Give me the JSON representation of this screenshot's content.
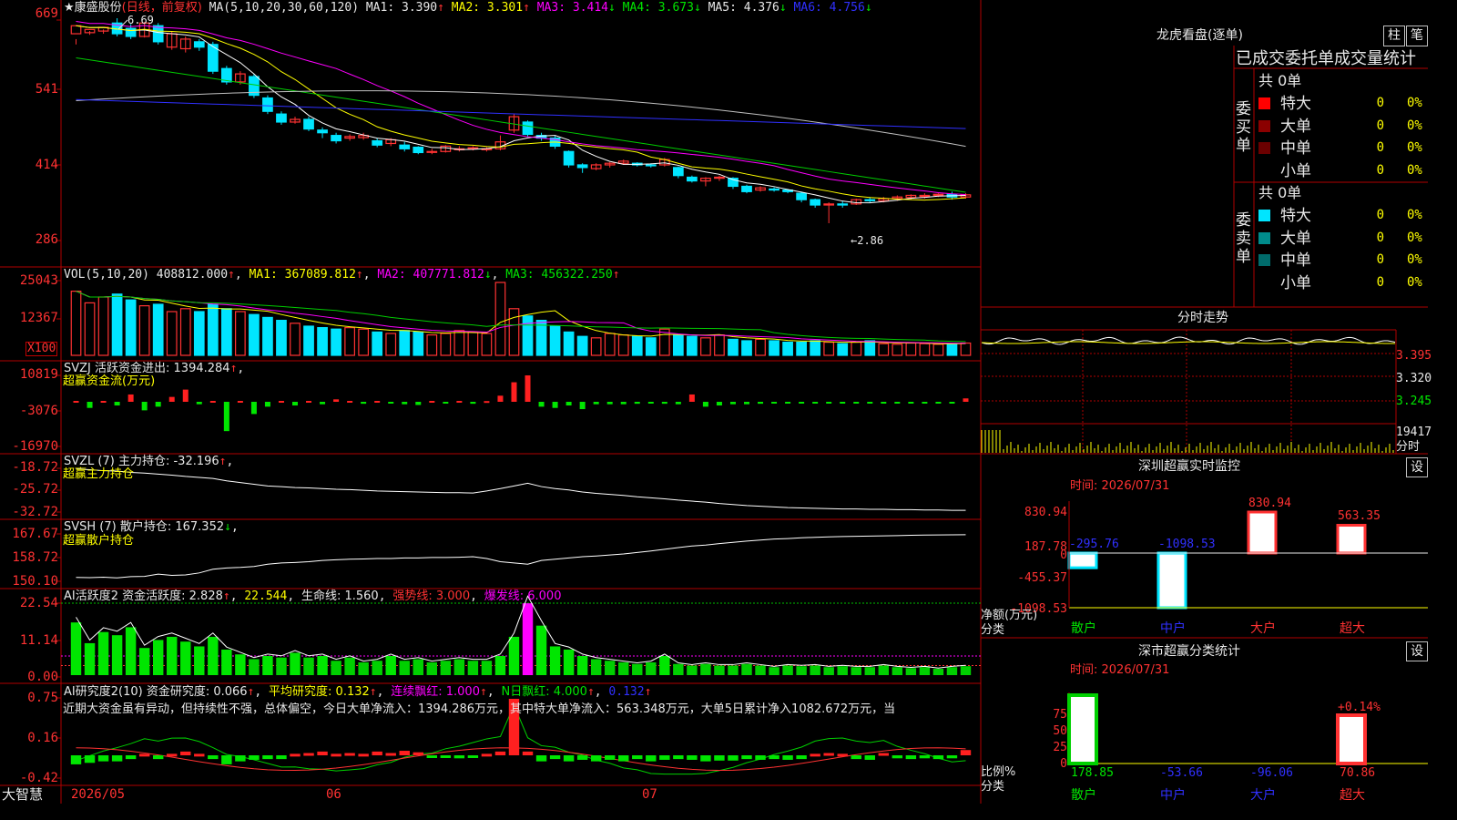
{
  "colors": {
    "up": "#ff3232",
    "down": "#00e5ff",
    "ma1": "#ffffff",
    "ma2": "#ffff00",
    "ma3": "#ff00ff",
    "ma4": "#00cc00",
    "ma5": "#c0c0c0",
    "ma6": "#3030ff",
    "pos": "#ff2020",
    "neg": "#00e600",
    "grid": "#c00000",
    "bg": "#000000"
  },
  "header": {
    "star": "★",
    "stock_name": "康盛股份",
    "period": "(日线，前复权)",
    "ma_params": "MA(5,10,20,30,60,120)",
    "ma1": "MA1: 3.390",
    "ma2": "MA2: 3.301",
    "ma3": "MA3: 3.414",
    "ma4": "MA4: 3.673",
    "ma5": "MA5: 4.376",
    "ma6": "MA6: 4.756",
    "up_arrow": "↑",
    "down_arrow": "↓",
    "peak_label": "6.69",
    "trough_label": "←2.86"
  },
  "price_axis": {
    "ticks": [
      "669",
      "541",
      "414",
      "286"
    ]
  },
  "vol": {
    "title": "VOL(5,10,20)",
    "val": "408812.000",
    "ma1": "MA1: 367089.812",
    "ma2": "MA2: 407771.812",
    "ma3": "MA3: 456322.250",
    "ticks": [
      "25043",
      "12367"
    ],
    "unit": "X100"
  },
  "svzj": {
    "title": "SVZJ  活跃资金进出: 1394.284",
    "sub": "超赢资金流(万元)",
    "ticks": [
      "10819",
      "-3076",
      "-16970"
    ]
  },
  "svzl": {
    "title": "SVZL (7) 主力持仓: -32.196",
    "sub": "超赢主力持仓",
    "ticks": [
      "-18.72",
      "-25.72",
      "-32.72"
    ]
  },
  "svsh": {
    "title": "SVSH (7) 散户持仓: 167.352",
    "sub": "超赢散户持仓",
    "ticks": [
      "167.67",
      "158.72",
      "150.10"
    ]
  },
  "ai2": {
    "title": "AI活跃度2 资金活跃度: 2.828",
    "v2": "22.544",
    "life": "生命线: 1.560",
    "strong": "强势线: 3.000",
    "burst": "爆发线: 6.000",
    "ticks": [
      "22.54",
      "11.14",
      "0.00"
    ]
  },
  "ai_res": {
    "title": "AI研究度2(10) 资金研究度: 0.066",
    "avg": "平均研究度: 0.132",
    "cont": "连续飘红: 1.000",
    "nred": "N日飘红: 4.000",
    "last": "0.132",
    "comment": "近期大资金虽有异动，但持续性不强，总体偏空，今日大单净流入：1394.286万元，其中特大单净流入：563.348万元，大单5日累计净入1082.672万元，当",
    "ticks": [
      "0.75",
      "0.16",
      "-0.42"
    ]
  },
  "date_axis": {
    "labels": [
      "2026/05",
      "06",
      "07"
    ]
  },
  "footer": {
    "brand": "大智慧"
  },
  "dragon": {
    "title": "龙虎看盘(逐单)",
    "btn1": "柱",
    "btn2": "笔",
    "header": "已成交委托单成交量统计",
    "buy_label": "委买单",
    "sell_label": "委卖单",
    "buy_total": "共 0单",
    "sell_total": "共 0单",
    "buy_rows": [
      {
        "name": "特大",
        "count": "0",
        "pct": "0%"
      },
      {
        "name": "大单",
        "count": "0",
        "pct": "0%"
      },
      {
        "name": "中单",
        "count": "0",
        "pct": "0%"
      },
      {
        "name": "小单",
        "count": "0",
        "pct": "0%"
      }
    ],
    "sell_rows": [
      {
        "name": "特大",
        "count": "0",
        "pct": "0%"
      },
      {
        "name": "大单",
        "count": "0",
        "pct": "0%"
      },
      {
        "name": "中单",
        "count": "0",
        "pct": "0%"
      },
      {
        "name": "小单",
        "count": "0",
        "pct": "0%"
      }
    ]
  },
  "intraday": {
    "title": "分时走势",
    "ticks": [
      "3.395",
      "3.320",
      "3.245"
    ],
    "vol_tick": "19417",
    "label": "分时"
  },
  "monitor": {
    "title": "深圳超赢实时监控",
    "btn": "设",
    "time": "时间: 2026/07/31",
    "yticks": [
      "830.94",
      "187.78",
      "0",
      "-455.37",
      "-1098.53"
    ],
    "ylabel": "净额(万元)",
    "xlabel": "分类",
    "cats": [
      "散户",
      "中户",
      "大户",
      "超大"
    ],
    "values": [
      -295.76,
      -1098.53,
      830.94,
      563.35
    ],
    "labels": [
      "-295.76",
      "-1098.53",
      "830.94",
      "563.35"
    ]
  },
  "stats": {
    "title": "深市超赢分类统计",
    "btn": "设",
    "time": "时间: 2026/07/31",
    "yticks": [
      "75",
      "50",
      "25",
      "0"
    ],
    "ylabel": "比例%",
    "xlabel": "分类",
    "cats": [
      "散户",
      "中户",
      "大户",
      "超大"
    ],
    "values": [
      "178.85",
      "-53.66",
      "-96.06",
      "70.86"
    ],
    "top_label": "+0.14%"
  },
  "chart_data": {
    "type": "candlestick",
    "dates": [
      "2026/05",
      "06",
      "07"
    ],
    "ohlc": [
      [
        6.4,
        6.55,
        6.3,
        6.2
      ],
      [
        6.42,
        6.48,
        6.45,
        6.38
      ],
      [
        6.45,
        6.52,
        6.48,
        6.4
      ],
      [
        6.6,
        6.4,
        6.69,
        6.35
      ],
      [
        6.5,
        6.35,
        6.58,
        6.3
      ],
      [
        6.35,
        6.6,
        6.62,
        6.33
      ],
      [
        6.55,
        6.25,
        6.6,
        6.2
      ],
      [
        6.15,
        6.4,
        6.45,
        6.1
      ],
      [
        6.12,
        6.3,
        6.35,
        6.05
      ],
      [
        6.25,
        6.15,
        6.3,
        6.08
      ],
      [
        6.2,
        5.7,
        6.25,
        5.65
      ],
      [
        5.75,
        5.5,
        5.8,
        5.45
      ],
      [
        5.5,
        5.65,
        5.7,
        5.45
      ],
      [
        5.6,
        5.25,
        5.65,
        5.2
      ],
      [
        5.2,
        4.95,
        5.25,
        4.9
      ],
      [
        4.9,
        4.75,
        4.95,
        4.7
      ],
      [
        4.75,
        4.8,
        4.85,
        4.72
      ],
      [
        4.8,
        4.62,
        4.85,
        4.58
      ],
      [
        4.6,
        4.55,
        4.65,
        4.45
      ],
      [
        4.5,
        4.4,
        4.55,
        4.35
      ],
      [
        4.45,
        4.48,
        4.52,
        4.4
      ],
      [
        4.46,
        4.5,
        4.55,
        4.42
      ],
      [
        4.4,
        4.32,
        4.45,
        4.28
      ],
      [
        4.35,
        4.42,
        4.45,
        4.3
      ],
      [
        4.32,
        4.25,
        4.38,
        4.2
      ],
      [
        4.28,
        4.18,
        4.3,
        4.15
      ],
      [
        4.2,
        4.2,
        4.25,
        4.15
      ],
      [
        4.2,
        4.3,
        4.32,
        4.18
      ],
      [
        4.25,
        4.25,
        4.3,
        4.2
      ],
      [
        4.25,
        4.27,
        4.3,
        4.22
      ],
      [
        4.25,
        4.25,
        4.28,
        4.2
      ],
      [
        4.25,
        4.38,
        4.5,
        4.22
      ],
      [
        4.6,
        4.85,
        4.9,
        4.55
      ],
      [
        4.75,
        4.52,
        4.78,
        4.48
      ],
      [
        4.5,
        4.45,
        4.55,
        4.4
      ],
      [
        4.45,
        4.3,
        4.5,
        4.25
      ],
      [
        4.2,
        3.95,
        4.22,
        3.9
      ],
      [
        3.95,
        3.9,
        3.98,
        3.8
      ],
      [
        3.88,
        3.95,
        3.98,
        3.85
      ],
      [
        3.95,
        3.98,
        4.0,
        3.9
      ],
      [
        3.98,
        4.02,
        4.05,
        3.95
      ],
      [
        3.98,
        3.95,
        4.0,
        3.92
      ],
      [
        3.95,
        3.94,
        3.98,
        3.9
      ],
      [
        3.95,
        4.05,
        4.08,
        3.92
      ],
      [
        3.9,
        3.75,
        3.92,
        3.7
      ],
      [
        3.72,
        3.65,
        3.75,
        3.62
      ],
      [
        3.65,
        3.7,
        3.72,
        3.55
      ],
      [
        3.7,
        3.72,
        3.75,
        3.65
      ],
      [
        3.7,
        3.55,
        3.72,
        3.5
      ],
      [
        3.55,
        3.45,
        3.58,
        3.42
      ],
      [
        3.48,
        3.52,
        3.55,
        3.45
      ],
      [
        3.5,
        3.48,
        3.53,
        3.45
      ],
      [
        3.48,
        3.45,
        3.5,
        3.42
      ],
      [
        3.42,
        3.3,
        3.45,
        3.25
      ],
      [
        3.3,
        3.2,
        3.32,
        3.15
      ],
      [
        3.2,
        3.22,
        3.25,
        2.86
      ],
      [
        3.22,
        3.2,
        3.28,
        3.15
      ],
      [
        3.22,
        3.3,
        3.32,
        3.2
      ],
      [
        3.3,
        3.28,
        3.35,
        3.25
      ],
      [
        3.28,
        3.32,
        3.35,
        3.25
      ],
      [
        3.32,
        3.35,
        3.38,
        3.28
      ],
      [
        3.34,
        3.38,
        3.4,
        3.3
      ],
      [
        3.36,
        3.38,
        3.42,
        3.32
      ],
      [
        3.38,
        3.4,
        3.42,
        3.35
      ],
      [
        3.4,
        3.35,
        3.45,
        3.3
      ],
      [
        3.35,
        3.39,
        3.42,
        3.32
      ]
    ],
    "volume": [
      220,
      180,
      200,
      210,
      190,
      170,
      175,
      150,
      160,
      150,
      175,
      160,
      150,
      140,
      130,
      120,
      110,
      100,
      95,
      90,
      95,
      90,
      80,
      75,
      85,
      80,
      70,
      75,
      85,
      80,
      75,
      250,
      160,
      135,
      120,
      100,
      80,
      65,
      60,
      75,
      70,
      65,
      60,
      90,
      70,
      65,
      60,
      70,
      55,
      50,
      55,
      50,
      45,
      45,
      50,
      45,
      40,
      45,
      50,
      40,
      38,
      42,
      40,
      38,
      40,
      42
    ],
    "fund_flow": [
      0,
      -2500,
      0,
      -1500,
      3000,
      -3500,
      -2000,
      2000,
      5000,
      -1000,
      0,
      -12000,
      0,
      -5000,
      -2000,
      0,
      -1500,
      0,
      -1000,
      1000,
      0,
      -800,
      0,
      -500,
      -1000,
      -1300,
      0,
      -600,
      0,
      -800,
      300,
      2500,
      8000,
      10819,
      -2000,
      -2500,
      -1500,
      -3000,
      -1000,
      -1000,
      -1000,
      -800,
      -500,
      -800,
      -1000,
      3000,
      -2000,
      -1500,
      -1000,
      -1000,
      -800,
      -600,
      -500,
      -500,
      -500,
      -500,
      -500,
      -500,
      -500,
      -500,
      -500,
      -500,
      -500,
      -500,
      -500,
      1394
    ],
    "main_pos": [
      -20.0,
      -20.2,
      -20.5,
      -20.6,
      -21.0,
      -21.2,
      -21.5,
      -21.8,
      -22.2,
      -22.5,
      -22.8,
      -23.5,
      -24.0,
      -24.5,
      -25.0,
      -25.2,
      -25.5,
      -25.6,
      -25.8,
      -26.0,
      -26.1,
      -26.3,
      -26.5,
      -26.6,
      -26.7,
      -26.8,
      -26.9,
      -27.0,
      -27.0,
      -27.1,
      -26.5,
      -25.8,
      -25.0,
      -24.2,
      -25.2,
      -25.8,
      -26.2,
      -26.8,
      -27.2,
      -27.5,
      -27.8,
      -28.2,
      -28.5,
      -28.8,
      -29.2,
      -29.5,
      -29.8,
      -30.2,
      -30.5,
      -30.8,
      -31.0,
      -31.2,
      -31.4,
      -31.5,
      -31.6,
      -31.7,
      -31.8,
      -31.8,
      -31.9,
      -31.9,
      -32.0,
      -32.0,
      -32.1,
      -32.1,
      -32.2,
      -32.2
    ],
    "retail_pos": [
      150.2,
      150.1,
      150.3,
      150.0,
      150.5,
      150.6,
      151.5,
      151.0,
      151.2,
      152.0,
      153.5,
      154.0,
      154.2,
      154.6,
      155.5,
      156.0,
      156.2,
      156.5,
      157.0,
      157.3,
      157.5,
      157.6,
      157.8,
      157.8,
      158.0,
      158.0,
      158.2,
      158.2,
      158.3,
      158.5,
      157.8,
      156.5,
      156.0,
      155.5,
      157.0,
      157.5,
      158.0,
      158.5,
      158.8,
      159.2,
      159.6,
      160.2,
      160.8,
      161.5,
      162.2,
      162.8,
      163.2,
      163.8,
      164.3,
      164.8,
      165.2,
      165.6,
      165.8,
      166.1,
      166.3,
      166.5,
      166.6,
      166.7,
      166.8,
      166.9,
      167.0,
      167.1,
      167.2,
      167.25,
      167.3,
      167.35
    ],
    "activity": [
      16.5,
      10.0,
      13.5,
      12.5,
      15.0,
      8.5,
      11.0,
      12.0,
      10.5,
      9.0,
      12.0,
      8.0,
      6.5,
      5.0,
      6.0,
      5.5,
      7.0,
      5.5,
      6.0,
      4.5,
      5.5,
      4.0,
      4.5,
      6.0,
      4.5,
      5.0,
      4.0,
      4.5,
      5.0,
      4.5,
      4.5,
      6.0,
      12.0,
      22.5,
      15.5,
      9.0,
      8.0,
      6.0,
      5.0,
      4.5,
      4.0,
      3.5,
      4.0,
      6.0,
      3.5,
      3.0,
      3.5,
      3.0,
      3.0,
      3.5,
      3.0,
      2.5,
      3.0,
      2.8,
      3.0,
      2.5,
      2.8,
      2.5,
      2.5,
      3.0,
      2.5,
      2.2,
      2.5,
      2.0,
      2.5,
      2.8
    ],
    "research": [
      -0.12,
      -0.1,
      -0.08,
      -0.08,
      -0.05,
      0.02,
      -0.05,
      0.02,
      0.05,
      0.02,
      -0.05,
      -0.12,
      -0.08,
      -0.06,
      -0.05,
      -0.05,
      0.02,
      0.03,
      0.05,
      0.02,
      0.03,
      0.02,
      0.05,
      0.03,
      0.06,
      0.04,
      -0.03,
      -0.02,
      -0.04,
      -0.02,
      0.02,
      0.05,
      0.75,
      0.05,
      -0.08,
      -0.05,
      -0.08,
      -0.06,
      -0.08,
      -0.06,
      -0.08,
      -0.05,
      -0.08,
      -0.06,
      -0.05,
      -0.06,
      -0.08,
      -0.07,
      -0.07,
      -0.05,
      -0.06,
      -0.05,
      -0.06,
      -0.05,
      0.02,
      0.03,
      0.02,
      -0.05,
      -0.06,
      0.03,
      -0.04,
      -0.05,
      -0.04,
      -0.05,
      -0.04,
      0.07
    ]
  }
}
